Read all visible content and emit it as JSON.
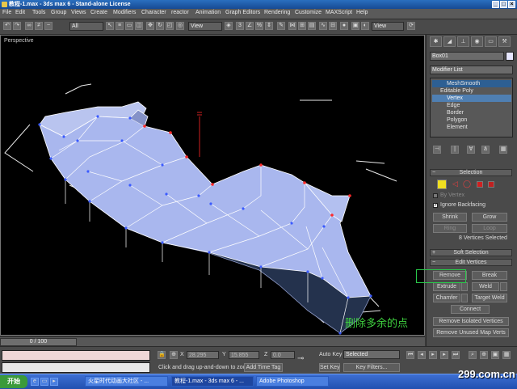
{
  "window": {
    "title": "教程-1.max - 3ds max 6 - Stand-alone License"
  },
  "menu": [
    "File",
    "Edit",
    "Tools",
    "Group",
    "Views",
    "Create",
    "Modifiers",
    "Character",
    "reactor",
    "Animation",
    "Graph Editors",
    "Rendering",
    "Customize",
    "MAXScript",
    "Help"
  ],
  "toolbar": {
    "filter_value": "All",
    "coord_value": "View",
    "right_select": "View"
  },
  "viewport": {
    "label": "Perspective",
    "caption": "删除多余的点"
  },
  "command_panel": {
    "object_name": "Box01",
    "object_color": "#e6e6ff",
    "modifier_list": "Modifier List",
    "stack": [
      "MeshSmooth",
      "Editable Poly",
      "Vertex",
      "Edge",
      "Border",
      "Polygon",
      "Element"
    ],
    "selection": {
      "title": "Selection",
      "by_vertex": "By Vertex",
      "ignore_backfacing": "Ignore Backfacing",
      "ignore_backfacing_checked": true,
      "shrink": "Shrink",
      "grow": "Grow",
      "ring": "Ring",
      "loop": "Loop",
      "status": "8 Vertices Selected"
    },
    "soft_selection": {
      "title": "Soft Selection"
    },
    "edit_vertices": {
      "title": "Edit Vertices",
      "remove": "Remove",
      "break": "Break",
      "extrude": "Extrude",
      "weld": "Weld",
      "chamfer": "Chamfer",
      "target_weld": "Target Weld",
      "connect": "Connect",
      "remove_isolated": "Remove Isolated Vertices",
      "remove_unused": "Remove Unused Map Verts"
    }
  },
  "timeline": {
    "frame": "0 / 100"
  },
  "status": {
    "x_label": "X",
    "x_value": "28.295",
    "y_label": "Y",
    "y_value": "15.855",
    "z_label": "Z",
    "z_value": "0.0",
    "prompt": "Click and drag up-and-down to zoo",
    "add_time_tag": "Add Time Tag",
    "auto_key": "Auto Key",
    "auto_key_value": "Selected",
    "set_key": "Set Key",
    "key_filters": "Key Filters..."
  },
  "taskbar": {
    "start": "开始",
    "items": [
      "火星时代动画大社区 - ...",
      "教程-1.max - 3ds max 6 - ...",
      "Adobe Photoshop"
    ],
    "watermark": "299.com.cn"
  }
}
